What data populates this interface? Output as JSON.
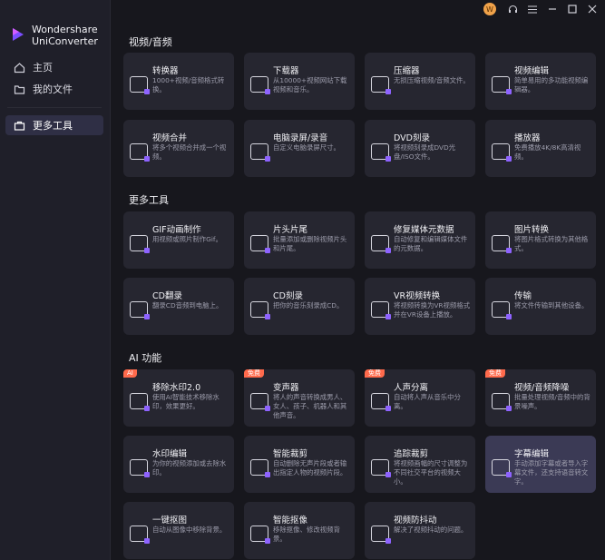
{
  "app": {
    "name_line1": "Wondershare",
    "name_line2": "UniConverter"
  },
  "sidebar": {
    "items": [
      {
        "label": "主页",
        "icon": "home-icon"
      },
      {
        "label": "我的文件",
        "icon": "folder-icon"
      },
      {
        "label": "更多工具",
        "icon": "toolbox-icon",
        "active": true
      }
    ]
  },
  "topbar": {
    "user_initial": "W"
  },
  "sections": [
    {
      "title": "视频/音频"
    },
    {
      "title": "更多工具"
    },
    {
      "title": "AI 功能"
    }
  ],
  "cards": [
    {
      "title": "转换器",
      "desc": "1000+视频/音频格式转换。",
      "icon": "convert-icon"
    },
    {
      "title": "下载器",
      "desc": "从10000+视频网站下载视频和音乐。",
      "icon": "download-icon"
    },
    {
      "title": "压缩器",
      "desc": "无损压缩视频/音频文件。",
      "icon": "compress-icon"
    },
    {
      "title": "视频编辑",
      "desc": "简单易用的多功能视频编辑器。",
      "icon": "video-edit-icon"
    },
    {
      "title": "视频合并",
      "desc": "将多个视频合并成一个视频。",
      "icon": "merge-icon"
    },
    {
      "title": "电脑录屏/录音",
      "desc": "自定义电脑录屏尺寸。",
      "icon": "screen-record-icon"
    },
    {
      "title": "DVD刻录",
      "desc": "将视频刻录成DVD光盘/ISO文件。",
      "icon": "dvd-icon"
    },
    {
      "title": "播放器",
      "desc": "免费播放4K/8K高清视频。",
      "icon": "player-icon"
    },
    {
      "title": "GIF动画制作",
      "desc": "用视频或照片制作Gif。",
      "icon": "gif-icon"
    },
    {
      "title": "片头片尾",
      "desc": "批量添加或删除视频片头和片尾。",
      "icon": "intro-outro-icon"
    },
    {
      "title": "修复媒体元数据",
      "desc": "自动修复和编辑媒体文件的元数据。",
      "icon": "metadata-icon"
    },
    {
      "title": "图片转换",
      "desc": "将图片格式转换为其他格式。",
      "icon": "image-convert-icon"
    },
    {
      "title": "CD翻录",
      "desc": "翻录CD音频到电脑上。",
      "icon": "cd-rip-icon"
    },
    {
      "title": "CD刻录",
      "desc": "把你的音乐刻录成CD。",
      "icon": "cd-burn-icon"
    },
    {
      "title": "VR视频转换",
      "desc": "将视频转换为VR视频格式并在VR设备上播放。",
      "icon": "vr-icon"
    },
    {
      "title": "传输",
      "desc": "将文件传输到其他设备。",
      "icon": "transfer-icon"
    },
    {
      "title": "移除水印2.0",
      "desc": "使用AI智能技术移除水印，效果更好。",
      "icon": "watermark-remove-icon",
      "badge": "AI"
    },
    {
      "title": "变声器",
      "desc": "将人的声音转换成男人、女人、孩子、机器人和其他声音。",
      "icon": "voice-changer-icon",
      "badge": "免费"
    },
    {
      "title": "人声分离",
      "desc": "自动将人声从音乐中分离。",
      "icon": "vocal-remover-icon",
      "badge": "免费"
    },
    {
      "title": "视频/音频降噪",
      "desc": "批量处理视频/音频中的背景噪声。",
      "icon": "noise-reduce-icon",
      "badge": "免费"
    },
    {
      "title": "水印编辑",
      "desc": "为你的视频添加或去除水印。",
      "icon": "watermark-edit-icon"
    },
    {
      "title": "智能裁剪",
      "desc": "自动删除无声片段或者输出指定人物的视频片段。",
      "icon": "smart-trim-icon"
    },
    {
      "title": "追踪裁剪",
      "desc": "将视频画幅的尺寸调整为不同社交平台的视频大小。",
      "icon": "auto-reframe-icon"
    },
    {
      "title": "字幕编辑",
      "desc": "手动添加字幕或者导入字幕文件，还支持语音转文字。",
      "icon": "subtitle-icon",
      "highlight": true
    },
    {
      "title": "一键抠图",
      "desc": "自动从图像中移除背景。",
      "icon": "bg-remover-icon"
    },
    {
      "title": "智能抠像",
      "desc": "移除抠像、修改视频背景。",
      "icon": "smart-portrait-icon"
    },
    {
      "title": "视频防抖动",
      "desc": "解决了视频抖动的问题。",
      "icon": "stabilize-icon"
    }
  ],
  "colors": {
    "accent": "#8e63ff",
    "badge": "#ff6a4c",
    "card": "#262630",
    "background": "#17171d"
  }
}
